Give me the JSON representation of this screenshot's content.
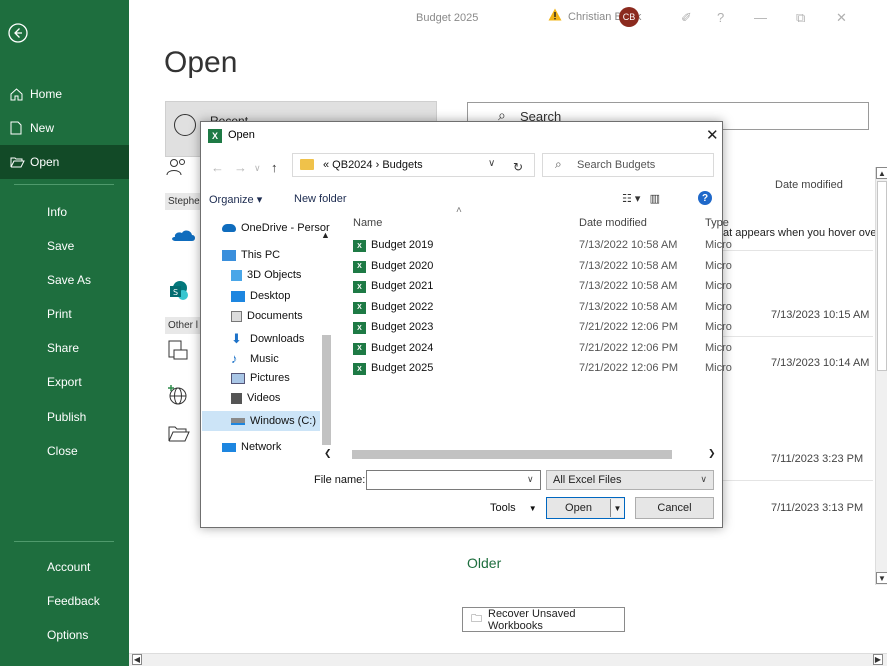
{
  "window": {
    "title": "Budget 2025",
    "user_name": "Christian Block",
    "avatar_initials": "CB"
  },
  "sidebar": {
    "items": [
      {
        "label": "Home"
      },
      {
        "label": "New"
      },
      {
        "label": "Open"
      },
      {
        "label": "Info"
      },
      {
        "label": "Save"
      },
      {
        "label": "Save As"
      },
      {
        "label": "Print"
      },
      {
        "label": "Share"
      },
      {
        "label": "Export"
      },
      {
        "label": "Publish"
      },
      {
        "label": "Close"
      },
      {
        "label": "Account"
      },
      {
        "label": "Feedback"
      },
      {
        "label": "Options"
      }
    ]
  },
  "backstage": {
    "title": "Open",
    "recent_label": "Recent",
    "section_stephen": "Stephe",
    "section_other": "Other l",
    "search_label": "Search",
    "date_modified_header": "Date modified",
    "hint_text": "at appears when you hover over",
    "dates": [
      "7/13/2023 10:15 AM",
      "7/13/2023 10:14 AM",
      "7/11/2023 3:23 PM",
      "7/11/2023 3:13 PM"
    ],
    "older_label": "Older",
    "recover_button": "Recover Unsaved Workbooks"
  },
  "dialog": {
    "title": "Open",
    "address_path": "«  QB2024  ›  Budgets",
    "search_placeholder": "Search Budgets",
    "organize_label": "Organize ▾",
    "new_folder_label": "New folder",
    "nav_items": [
      {
        "label": "OneDrive - Persor"
      },
      {
        "label": "This PC"
      },
      {
        "label": "3D Objects"
      },
      {
        "label": "Desktop"
      },
      {
        "label": "Documents"
      },
      {
        "label": "Downloads"
      },
      {
        "label": "Music"
      },
      {
        "label": "Pictures"
      },
      {
        "label": "Videos"
      },
      {
        "label": "Windows (C:)"
      },
      {
        "label": "Network"
      }
    ],
    "columns": {
      "name": "Name",
      "date_modified": "Date modified",
      "type": "Type"
    },
    "files": [
      {
        "name": "Budget 2019",
        "date": "7/13/2022 10:58 AM",
        "type": "Micro"
      },
      {
        "name": "Budget 2020",
        "date": "7/13/2022 10:58 AM",
        "type": "Micro"
      },
      {
        "name": "Budget 2021",
        "date": "7/13/2022 10:58 AM",
        "type": "Micro"
      },
      {
        "name": "Budget 2022",
        "date": "7/13/2022 10:58 AM",
        "type": "Micro"
      },
      {
        "name": "Budget 2023",
        "date": "7/21/2022 12:06 PM",
        "type": "Micro"
      },
      {
        "name": "Budget 2024",
        "date": "7/21/2022 12:06 PM",
        "type": "Micro"
      },
      {
        "name": "Budget 2025",
        "date": "7/21/2022 12:06 PM",
        "type": "Micro"
      }
    ],
    "file_name_label": "File name:",
    "file_name_value": "",
    "filter_value": "All Excel Files",
    "tools_label": "Tools",
    "open_label": "Open",
    "cancel_label": "Cancel"
  },
  "colors": {
    "sidebar": "#1e6e3e",
    "sidebar_active": "#124a27",
    "accent": "#0067c0"
  }
}
